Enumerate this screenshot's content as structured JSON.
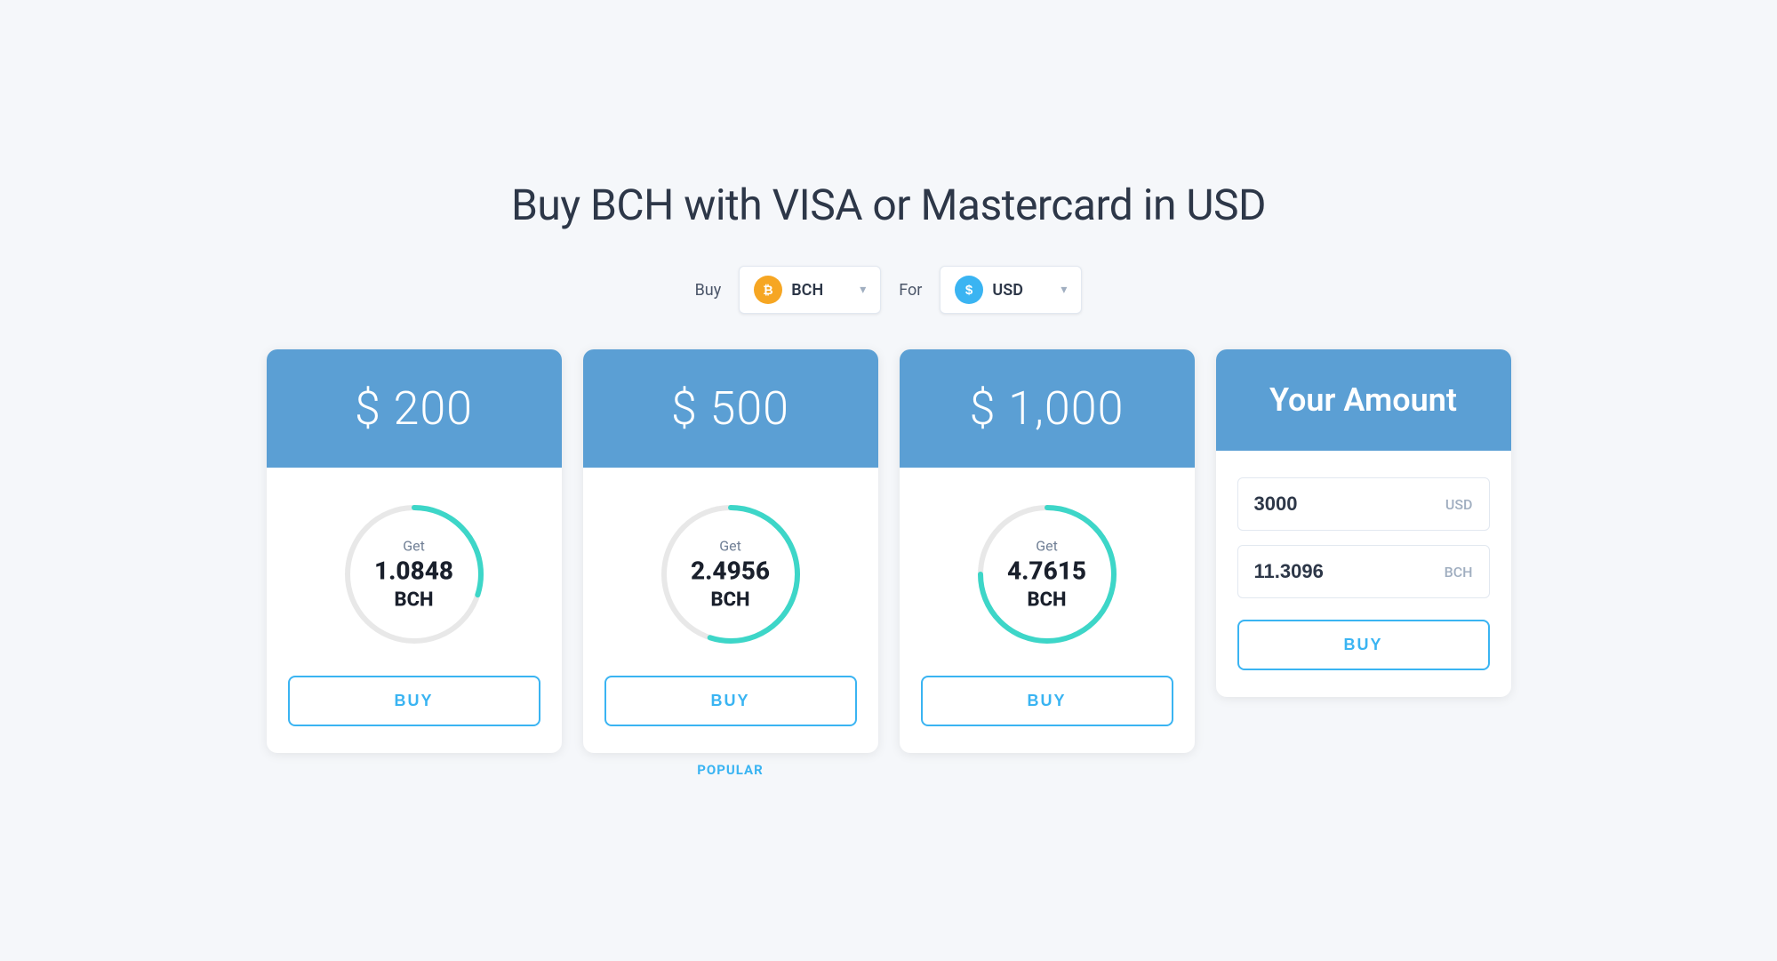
{
  "page": {
    "title": "Buy BCH with VISA or Mastercard in USD"
  },
  "controls": {
    "buy_label": "Buy",
    "for_label": "For",
    "buy_coin": {
      "symbol": "BCH",
      "icon_type": "bch"
    },
    "for_coin": {
      "symbol": "USD",
      "icon_type": "usd"
    },
    "chevron": "▾"
  },
  "cards": [
    {
      "id": "card-200",
      "header_amount": "$ 200",
      "get_label": "Get",
      "get_value": "1.0848",
      "get_currency": "BCH",
      "buy_label": "BUY",
      "popular": false,
      "progress_pct": 30
    },
    {
      "id": "card-500",
      "header_amount": "$ 500",
      "get_label": "Get",
      "get_value": "2.4956",
      "get_currency": "BCH",
      "buy_label": "BUY",
      "popular": true,
      "popular_text": "POPULAR",
      "progress_pct": 55
    },
    {
      "id": "card-1000",
      "header_amount": "$ 1,000",
      "get_label": "Get",
      "get_value": "4.7615",
      "get_currency": "BCH",
      "buy_label": "BUY",
      "popular": false,
      "progress_pct": 75
    }
  ],
  "your_amount_card": {
    "header_text": "Your Amount",
    "usd_value": "3000",
    "usd_currency": "USD",
    "bch_value": "11.3096",
    "bch_currency": "BCH",
    "buy_label": "BUY"
  }
}
